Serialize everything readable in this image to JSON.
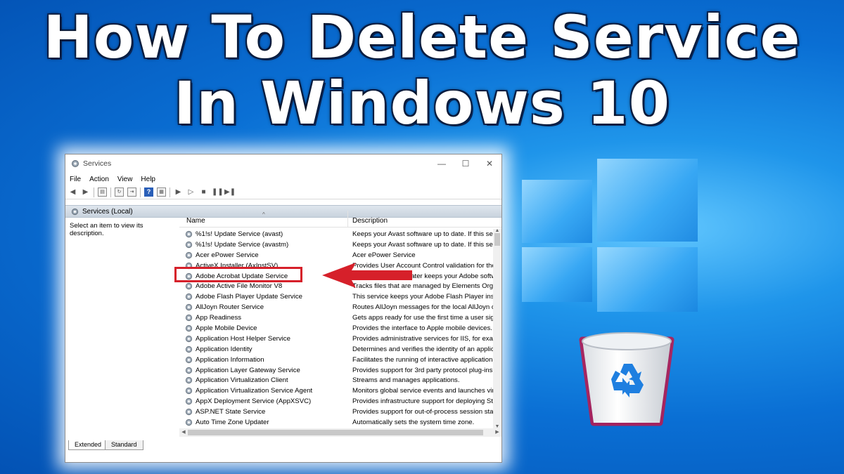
{
  "headline": {
    "line1": "How To Delete Service",
    "line2": "In Windows 10"
  },
  "window": {
    "title": "Services",
    "controls": {
      "minimize": "—",
      "maximize": "☐",
      "close": "✕"
    },
    "menu": [
      "File",
      "Action",
      "View",
      "Help"
    ],
    "scope_label": "Services (Local)",
    "left_panel_text": "Select an item to view its description.",
    "columns": {
      "name": "Name",
      "description": "Description"
    },
    "rows": [
      {
        "name": "%1!s! Update Service (avast)",
        "desc": "Keeps your Avast software up to date. If this serv"
      },
      {
        "name": "%1!s! Update Service (avastm)",
        "desc": "Keeps your Avast software up to date. If this serv"
      },
      {
        "name": "Acer ePower Service",
        "desc": "Acer ePower Service"
      },
      {
        "name": "ActiveX Installer (AxInstSV)",
        "desc": "Provides User Account Control validation for the"
      },
      {
        "name": "Adobe Acrobat Update Service",
        "desc": "Adobe Acrobat Updater keeps your Adobe softw"
      },
      {
        "name": "Adobe Active File Monitor V8",
        "desc": "Tracks files that are managed by Elements Organ"
      },
      {
        "name": "Adobe Flash Player Update Service",
        "desc": "This service keeps your Adobe Flash Player insta"
      },
      {
        "name": "AllJoyn Router Service",
        "desc": "Routes AllJoyn messages for the local AllJoyn cli"
      },
      {
        "name": "App Readiness",
        "desc": "Gets apps ready for use the first time a user signs"
      },
      {
        "name": "Apple Mobile Device",
        "desc": "Provides the interface to Apple mobile devices."
      },
      {
        "name": "Application Host Helper Service",
        "desc": "Provides administrative services for IIS, for exam"
      },
      {
        "name": "Application Identity",
        "desc": "Determines and verifies the identity of an applica"
      },
      {
        "name": "Application Information",
        "desc": "Facilitates the running of interactive applications"
      },
      {
        "name": "Application Layer Gateway Service",
        "desc": "Provides support for 3rd party protocol plug-ins"
      },
      {
        "name": "Application Virtualization Client",
        "desc": "Streams and manages applications."
      },
      {
        "name": "Application Virtualization Service Agent",
        "desc": "Monitors global service events and launches virt"
      },
      {
        "name": "AppX Deployment Service (AppXSVC)",
        "desc": "Provides infrastructure support for deploying Sto"
      },
      {
        "name": "ASP.NET State Service",
        "desc": "Provides support for out-of-process session stat"
      },
      {
        "name": "Auto Time Zone Updater",
        "desc": "Automatically sets the system time zone."
      }
    ],
    "tabs": [
      "Extended",
      "Standard"
    ]
  },
  "colors": {
    "highlight": "#d6202a",
    "background": "#0a6fd4",
    "scope_bar": "#c9d3de"
  }
}
